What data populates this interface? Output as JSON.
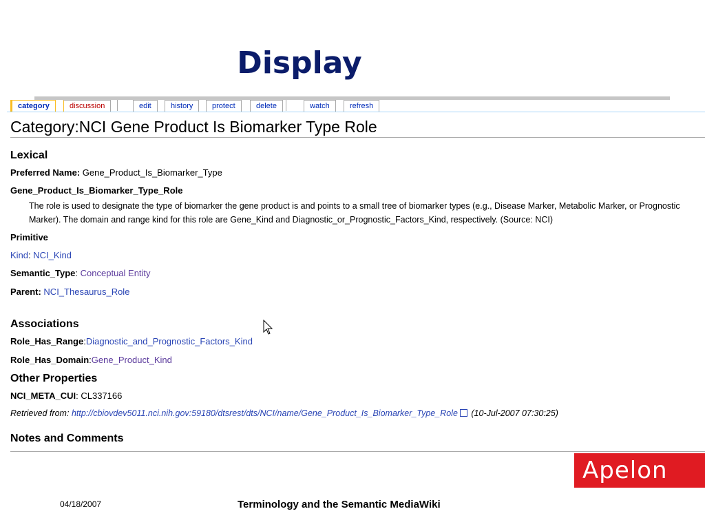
{
  "slide": {
    "title": "Display",
    "footer_date": "04/18/2007",
    "footer_title": "Terminology and the Semantic MediaWiki",
    "logo_text": "Apelon"
  },
  "tabs": [
    {
      "label": "category",
      "selected": true
    },
    {
      "label": "discussion"
    },
    {
      "label": "edit"
    },
    {
      "label": "history"
    },
    {
      "label": "protect"
    },
    {
      "label": "delete"
    },
    {
      "label": "watch"
    },
    {
      "label": "refresh"
    }
  ],
  "page": {
    "heading": "Category:NCI Gene Product Is Biomarker Type Role",
    "lexical": {
      "section": "Lexical",
      "preferred_name_label": "Preferred Name:",
      "preferred_name_value": "Gene_Product_Is_Biomarker_Type",
      "term": "Gene_Product_Is_Biomarker_Type_Role",
      "definition": "The role is used to designate the type of biomarker the gene product is and points to a small tree of biomarker types (e.g., Disease Marker, Metabolic Marker, or Prognostic Marker). The domain and range kind for this role are Gene_Kind and Diagnostic_or_Prognostic_Factors_Kind, respectively. (Source: NCI)"
    },
    "primitive": {
      "section": "Primitive",
      "kind_label": "Kind",
      "kind_value": "NCI_Kind",
      "semantic_type_label": "Semantic_Type",
      "semantic_type_value": "Conceptual Entity",
      "parent_label": "Parent:",
      "parent_value": "NCI_Thesaurus_Role"
    },
    "associations": {
      "section": "Associations",
      "range_label": "Role_Has_Range",
      "range_value": "Diagnostic_and_Prognostic_Factors_Kind",
      "domain_label": "Role_Has_Domain",
      "domain_value": "Gene_Product_Kind"
    },
    "other": {
      "section": "Other Properties",
      "cui_label": "NCI_META_CUI",
      "cui_value": "CL337166"
    },
    "retrieved": {
      "prefix": "Retrieved from:",
      "url": "http://cbiovdev5011.nci.nih.gov:59180/dtsrest/dts/NCI/name/Gene_Product_Is_Biomarker_Type_Role",
      "date": "(10-Jul-2007 07:30:25)"
    },
    "notes_section": "Notes and Comments"
  }
}
